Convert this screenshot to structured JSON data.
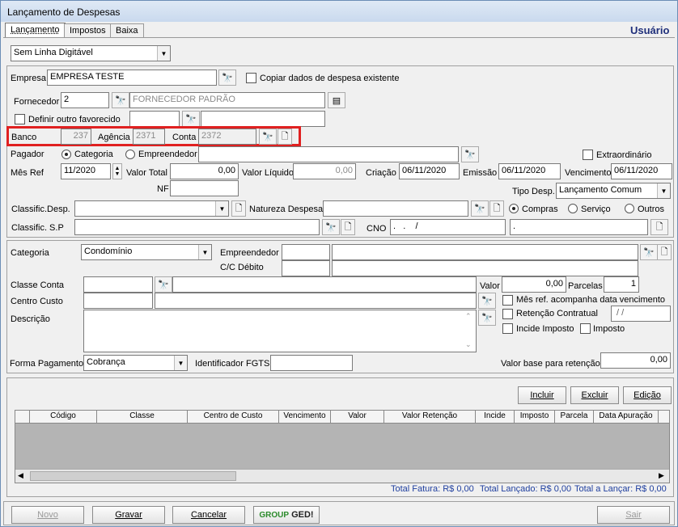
{
  "window_title": "Lançamento de Despesas",
  "user_label": "Usuário",
  "tabs": [
    "Lançamento",
    "Impostos",
    "Baixa"
  ],
  "linha_digitavel": "Sem Linha Digitável",
  "empresa": {
    "label": "Empresa",
    "value": "EMPRESA TESTE"
  },
  "copiar_label": "Copiar dados de despesa existente",
  "fornecedor": {
    "label": "Fornecedor",
    "code": "2",
    "name": "FORNECEDOR PADRÃO"
  },
  "definir_favorecido_label": "Definir outro favorecido",
  "banco": {
    "label": "Banco",
    "value": "237"
  },
  "agencia": {
    "label": "Agência",
    "value": "2371"
  },
  "conta": {
    "label": "Conta",
    "value": "2372"
  },
  "pagador": {
    "label": "Pagador",
    "opt1": "Categoria",
    "opt2": "Empreendedor"
  },
  "extraordinario_label": "Extraordinário",
  "mes_ref": {
    "label": "Mês Ref",
    "value": "11/2020"
  },
  "valor_total": {
    "label": "Valor Total",
    "value": "0,00"
  },
  "valor_liquido": {
    "label": "Valor Líquido",
    "value": "0,00"
  },
  "criacao": {
    "label": "Criação",
    "value": "06/11/2020"
  },
  "emissao": {
    "label": "Emissão",
    "value": "06/11/2020"
  },
  "vencimento": {
    "label": "Vencimento",
    "value": "06/11/2020"
  },
  "nf_label": "NF",
  "tipo_desp": {
    "label": "Tipo Desp.",
    "value": "Lançamento Comum"
  },
  "classific_desp_label": "Classific.Desp.",
  "natureza_label": "Natureza Despesa",
  "radios_tipo": [
    "Compras",
    "Serviço",
    "Outros"
  ],
  "classific_sp_label": "Classific. S.P",
  "cno": {
    "label": "CNO",
    "value": ".   .    /",
    "value2": "."
  },
  "categoria": {
    "label": "Categoria",
    "value": "Condomínio"
  },
  "empreendedor_label": "Empreendedor",
  "cc_debito_label": "C/C Débito",
  "classe_conta_label": "Classe Conta",
  "valor": {
    "label": "Valor",
    "value": "0,00"
  },
  "parcelas": {
    "label": "Parcelas",
    "value": "1"
  },
  "centro_custo_label": "Centro Custo",
  "mes_ref_acomp_label": "Mês ref. acompanha data vencimento",
  "retencao_contratual": {
    "label": "Retenção Contratual",
    "value": " / /"
  },
  "incide_imposto_label": "Incide Imposto",
  "imposto_label": "Imposto",
  "descricao_label": "Descrição",
  "forma_pagamento": {
    "label": "Forma Pagamento",
    "value": "Cobrança"
  },
  "identificador_fgts_label": "Identificador FGTS",
  "valor_base_retencao": {
    "label": "Valor base para retenção",
    "value": "0,00"
  },
  "grid_buttons": [
    "Incluir",
    "Excluir",
    "Edição"
  ],
  "grid_columns": [
    "Código",
    "Classe",
    "Centro de Custo",
    "Vencimento",
    "Valor",
    "Valor Retenção",
    "Incide",
    "Imposto",
    "Parcela",
    "Data Apuração"
  ],
  "totals": {
    "fatura": "Total Fatura: R$ 0,00",
    "lancado": "Total Lançado: R$ 0,00",
    "a_lancar": "Total a Lançar: R$ 0,00"
  },
  "footer_buttons": {
    "novo": "Novo",
    "gravar": "Gravar",
    "cancelar": "Cancelar",
    "sair": "Sair"
  },
  "logo_text": {
    "a": "GROUP",
    "b": "GED!"
  },
  "colors": {
    "highlight": "#e02020",
    "title_user": "#1f2f7a",
    "grid_bg": "#b4b4b4"
  }
}
